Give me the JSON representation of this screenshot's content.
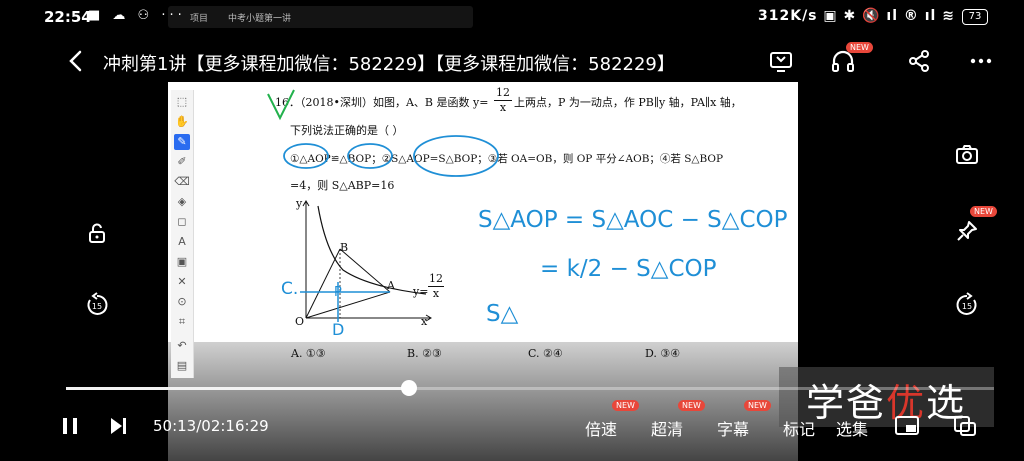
{
  "status": {
    "time": "22:54",
    "speed": "312K/s",
    "battery": "73"
  },
  "window_strip": {
    "tab1": "项目",
    "tab2": "中考小题第一讲"
  },
  "header": {
    "title": "冲刺第1讲【更多课程加微信：582229】【更多课程加微信：582229】",
    "badge_new": "NEW"
  },
  "problem": {
    "line1_a": "16．（2018•深圳）如图，A、B 是函数 y=",
    "frac_num": "12",
    "frac_den": "x",
    "line1_b": "上两点，P 为一动点，作 PB∥y 轴，PA∥x 轴，",
    "line2": "下列说法正确的是（      ）",
    "line3": "①△AOP≌△BOP；②S△AOP=S△BOP；③若 OA=OB，则 OP 平分∠AOB；④若 S△BOP",
    "line4": "=4，则 S△ABP=16",
    "options": [
      "A. ①③",
      "B. ②③",
      "C. ②④",
      "D. ③④"
    ],
    "graph_labels": {
      "y": "y",
      "x": "x",
      "o": "O",
      "b": "B",
      "a": "A",
      "func": "y=",
      "fn": "12",
      "fd": "x"
    }
  },
  "handwriting": {
    "eq1": "S△AOP = S△AOC − S△COP",
    "eq2": "= k/2 − S△COP",
    "partial": "S△",
    "c_label": "C.",
    "p_label": "P",
    "d_label": "D"
  },
  "player": {
    "timecode": "50:13/02:16:29",
    "progress": 0.37,
    "speed_label": "倍速",
    "quality_label": "超清",
    "subtitle_label": "字幕",
    "mark_label": "标记",
    "episodes_label": "选集",
    "new_badge": "NEW",
    "skip_seconds": "15"
  },
  "watermark": {
    "c1": "学",
    "c2": "爸",
    "c3": "优",
    "c4": "选"
  }
}
